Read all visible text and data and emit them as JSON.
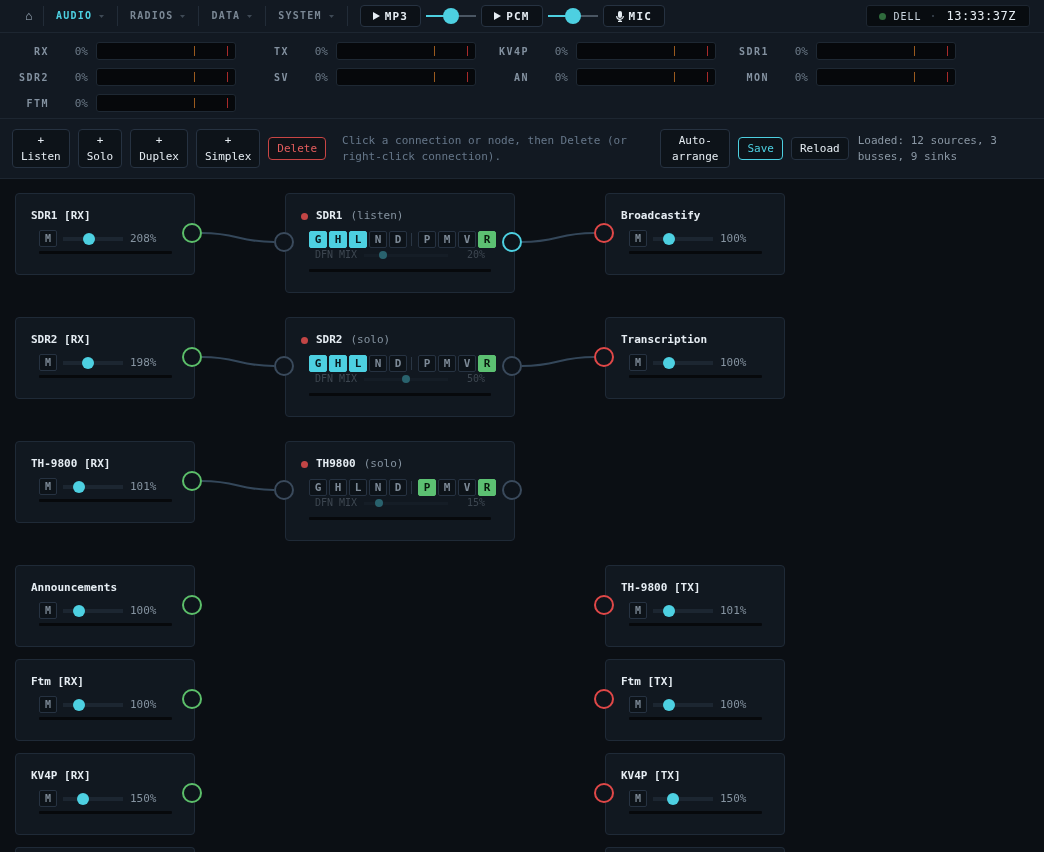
{
  "nav": {
    "home": "⌂",
    "menus": [
      {
        "label": "AUDIO",
        "selected": true
      },
      {
        "label": "RADIOS",
        "selected": false
      },
      {
        "label": "DATA",
        "selected": false
      },
      {
        "label": "SYSTEM",
        "selected": false
      }
    ]
  },
  "streams": [
    {
      "kind": "play",
      "label": "MP3",
      "volume": {
        "level": 0.5
      }
    },
    {
      "kind": "play",
      "label": "PCM",
      "volume": {
        "level": 0.5
      }
    },
    {
      "kind": "mic",
      "label": "MIC"
    }
  ],
  "status": {
    "host": "DELL",
    "time": "13:33:37Z"
  },
  "meters": [
    {
      "label": "RX",
      "reading": "0%",
      "level": 0
    },
    {
      "label": "TX",
      "reading": "0%",
      "level": 0
    },
    {
      "label": "KV4P",
      "reading": "0%",
      "level": 0
    },
    {
      "label": "SDR1",
      "reading": "0%",
      "level": 0
    },
    {
      "label": "SDR2",
      "reading": "0%",
      "level": 0
    },
    {
      "label": "SV",
      "reading": "0%",
      "level": 0
    },
    {
      "label": "AN",
      "reading": "0%",
      "level": 0
    },
    {
      "label": "MON",
      "reading": "0%",
      "level": 0
    },
    {
      "label": "FTM",
      "reading": "0%",
      "level": 0
    }
  ],
  "toolbar": {
    "add_buttons": [
      "+ Listen",
      "+ Solo",
      "+ Duplex",
      "+ Simplex"
    ],
    "delete": "Delete",
    "hint": "Click a connection or node, then Delete (or right-click connection).",
    "auto_arrange": "Auto-arrange",
    "save": "Save",
    "reload": "Reload",
    "summary": "Loaded: 12 sources, 3 busses, 9 sinks"
  },
  "graph": {
    "routes": [
      {
        "source": {
          "title": "SDR1 [RX]",
          "mute": "M",
          "volume": {
            "level": 0.42
          },
          "reading": "208%",
          "meter": {
            "level": 0
          }
        },
        "wired_in": true,
        "bus": {
          "name": "SDR1",
          "mode": "(listen)",
          "toggle_groups": [
            {
              "kind": "filter",
              "toggles": [
                {
                  "label": "G",
                  "on": true
                },
                {
                  "label": "H",
                  "on": true
                },
                {
                  "label": "L",
                  "on": true
                },
                {
                  "label": "N",
                  "on": false
                },
                {
                  "label": "D",
                  "on": false
                }
              ]
            },
            {
              "kind": "route",
              "toggles": [
                {
                  "label": "P",
                  "on": false
                },
                {
                  "label": "M",
                  "on": false
                },
                {
                  "label": "V",
                  "on": false
                },
                {
                  "label": "R",
                  "on": true
                }
              ]
            }
          ],
          "dfn": {
            "label": "DFN MIX",
            "level": 0.2,
            "reading": "20%",
            "disabled": true
          },
          "meter": {
            "level": 0
          },
          "output_active": true
        },
        "wired_out": true,
        "sink": {
          "title": "Broadcastify",
          "mute": "M",
          "volume": {
            "level": 0.21
          },
          "reading": "100%",
          "meter": {
            "level": 0
          }
        }
      },
      {
        "source": {
          "title": "SDR2 [RX]",
          "mute": "M",
          "volume": {
            "level": 0.4
          },
          "reading": "198%",
          "meter": {
            "level": 0
          }
        },
        "wired_in": true,
        "bus": {
          "name": "SDR2",
          "mode": "(solo)",
          "toggle_groups": [
            {
              "kind": "filter",
              "toggles": [
                {
                  "label": "G",
                  "on": true
                },
                {
                  "label": "H",
                  "on": true
                },
                {
                  "label": "L",
                  "on": true
                },
                {
                  "label": "N",
                  "on": false
                },
                {
                  "label": "D",
                  "on": false
                }
              ]
            },
            {
              "kind": "route",
              "toggles": [
                {
                  "label": "P",
                  "on": false
                },
                {
                  "label": "M",
                  "on": false
                },
                {
                  "label": "V",
                  "on": false
                },
                {
                  "label": "R",
                  "on": true
                }
              ]
            }
          ],
          "dfn": {
            "label": "DFN MIX",
            "level": 0.5,
            "reading": "50%",
            "disabled": true
          },
          "meter": {
            "level": 0
          },
          "output_active": false
        },
        "wired_out": true,
        "sink": {
          "title": "Transcription",
          "mute": "M",
          "volume": {
            "level": 0.21
          },
          "reading": "100%",
          "meter": {
            "level": 0
          }
        }
      },
      {
        "source": {
          "title": "TH-9800 [RX]",
          "mute": "M",
          "volume": {
            "level": 0.21
          },
          "reading": "101%",
          "meter": {
            "level": 0
          }
        },
        "wired_in": true,
        "bus": {
          "name": "TH9800",
          "mode": "(solo)",
          "toggle_groups": [
            {
              "kind": "filter",
              "toggles": [
                {
                  "label": "G",
                  "on": false
                },
                {
                  "label": "H",
                  "on": false
                },
                {
                  "label": "L",
                  "on": false
                },
                {
                  "label": "N",
                  "on": false
                },
                {
                  "label": "D",
                  "on": false
                }
              ]
            },
            {
              "kind": "route",
              "toggles": [
                {
                  "label": "P",
                  "on": true
                },
                {
                  "label": "M",
                  "on": false
                },
                {
                  "label": "V",
                  "on": false
                },
                {
                  "label": "R",
                  "on": true
                }
              ]
            }
          ],
          "dfn": {
            "label": "DFN MIX",
            "level": 0.15,
            "reading": "15%",
            "disabled": true
          },
          "meter": {
            "level": 0
          },
          "output_active": false
        },
        "wired_out": false
      }
    ],
    "pairs": [
      {
        "source": {
          "title": "Announcements",
          "mute": "M",
          "volume": {
            "level": 0.21
          },
          "reading": "100%",
          "meter": {
            "level": 0
          }
        },
        "sink": {
          "title": "TH-9800 [TX]",
          "mute": "M",
          "volume": {
            "level": 0.21
          },
          "reading": "101%",
          "meter": {
            "level": 0
          }
        }
      },
      {
        "source": {
          "title": "Ftm [RX]",
          "mute": "M",
          "volume": {
            "level": 0.21
          },
          "reading": "100%",
          "meter": {
            "level": 0
          }
        },
        "sink": {
          "title": "Ftm [TX]",
          "mute": "M",
          "volume": {
            "level": 0.21
          },
          "reading": "100%",
          "meter": {
            "level": 0
          }
        }
      },
      {
        "source": {
          "title": "KV4P [RX]",
          "mute": "M",
          "volume": {
            "level": 0.29
          },
          "reading": "150%",
          "meter": {
            "level": 0
          }
        },
        "sink": {
          "title": "KV4P [TX]",
          "mute": "M",
          "volume": {
            "level": 0.29
          },
          "reading": "150%",
          "meter": {
            "level": 0
          }
        }
      }
    ],
    "more_below": true
  }
}
